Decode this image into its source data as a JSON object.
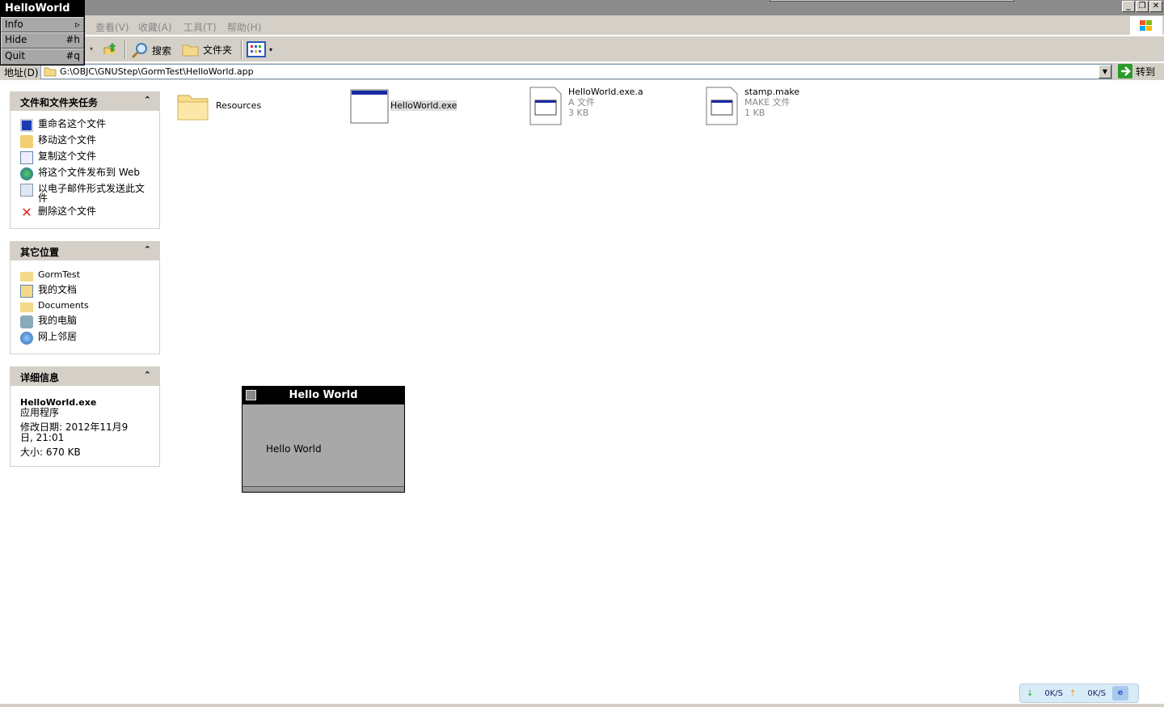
{
  "app_menu": {
    "title": "HelloWorld",
    "items": [
      {
        "label": "Info",
        "shortcut": "▹"
      },
      {
        "label": "Hide",
        "shortcut": "#h"
      },
      {
        "label": "Quit",
        "shortcut": "#q"
      }
    ]
  },
  "menubar": [
    "查看(V)",
    "收藏(A)",
    "工具(T)",
    "帮助(H)"
  ],
  "toolbar": {
    "search": "搜索",
    "folders": "文件夹"
  },
  "address": {
    "label": "地址(D)",
    "value": "G:\\OBJC\\GNUStep\\GormTest\\HelloWorld.app",
    "go": "转到"
  },
  "tasks": {
    "title": "文件和文件夹任务",
    "items": [
      "重命名这个文件",
      "移动这个文件",
      "复制这个文件",
      "将这个文件发布到 Web",
      "以电子邮件形式发送此文件",
      "删除这个文件"
    ]
  },
  "places": {
    "title": "其它位置",
    "items": [
      "GormTest",
      "我的文档",
      "Documents",
      "我的电脑",
      "网上邻居"
    ]
  },
  "details": {
    "title": "详细信息",
    "name": "HelloWorld.exe",
    "type": "应用程序",
    "modified": "修改日期: 2012年11月9日, 21:01",
    "size": "大小: 670 KB"
  },
  "files": [
    {
      "name": "Resources"
    },
    {
      "name": "HelloWorld.exe"
    },
    {
      "name": "HelloWorld.exe.a",
      "type": "A 文件",
      "size": "3 KB"
    },
    {
      "name": "stamp.make",
      "type": "MAKE 文件",
      "size": "1 KB"
    }
  ],
  "hello_window": {
    "title": "Hello World",
    "text": "Hello World"
  },
  "tray": {
    "down": "0K/S",
    "up": "0K/S"
  }
}
